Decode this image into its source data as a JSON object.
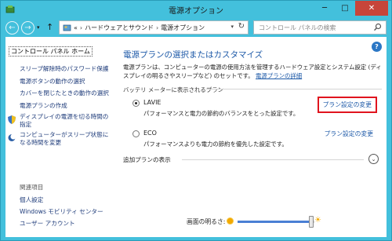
{
  "window": {
    "title": "電源オプション",
    "controls": {
      "minimize": "─",
      "maximize": "□",
      "close": "✕"
    }
  },
  "address": {
    "back_glyph": "←",
    "forward_glyph": "→",
    "dropdown_glyph": "▾",
    "up_glyph": "↑",
    "prefix": "«",
    "crumbs": [
      "ハードウェアとサウンド",
      "電源オプション"
    ],
    "separator": "›",
    "caret": "▾",
    "refresh": "↻"
  },
  "search": {
    "placeholder": "コントロール パネルの検索",
    "icon": "search-icon"
  },
  "sidebar": {
    "home": "コントロール パネル ホーム",
    "links": [
      "スリープ解除時のパスワード保護",
      "電源ボタンの動作の選択",
      "カバーを閉じたときの動作の選択",
      "電源プランの作成"
    ],
    "shield_links": [
      "ディスプレイの電源を切る時間の指定",
      "コンピューターがスリープ状態になる時間を変更"
    ],
    "see_also": "関連項目",
    "see_also_links": [
      "個人設定",
      "Windows モビリティ センター",
      "ユーザー アカウント"
    ]
  },
  "main": {
    "help": "?",
    "title": "電源プランの選択またはカスタマイズ",
    "description": "電源プランは、コンピューターの電源の使用方法を管理するハードウェア設定とシステム設定 (ディスプレイの明るさやスリープなど) のセットです。",
    "description_link": "電源プランの詳細",
    "group_heading": "バッテリ メーターに表示されるプラン",
    "plans": [
      {
        "name": "LAVIE",
        "selected": true,
        "description": "パフォーマンスと電力の節約のバランスをとった設定です。",
        "change_label": "プラン設定の変更",
        "highlighted": true
      },
      {
        "name": "ECO",
        "selected": false,
        "description": "パフォーマンスよりも電力の節約を優先した設定です。",
        "change_label": "プラン設定の変更",
        "highlighted": false
      }
    ],
    "additional_plans": "追加プランの表示",
    "expand_glyph": "⌄"
  },
  "brightness": {
    "label": "画面の明るさ:",
    "level_percent": 96,
    "sun_big": "☀"
  },
  "colors": {
    "accent": "#43c0dc",
    "link": "#1e5aa8",
    "highlight": "#e0141e",
    "close": "#c7453a"
  }
}
